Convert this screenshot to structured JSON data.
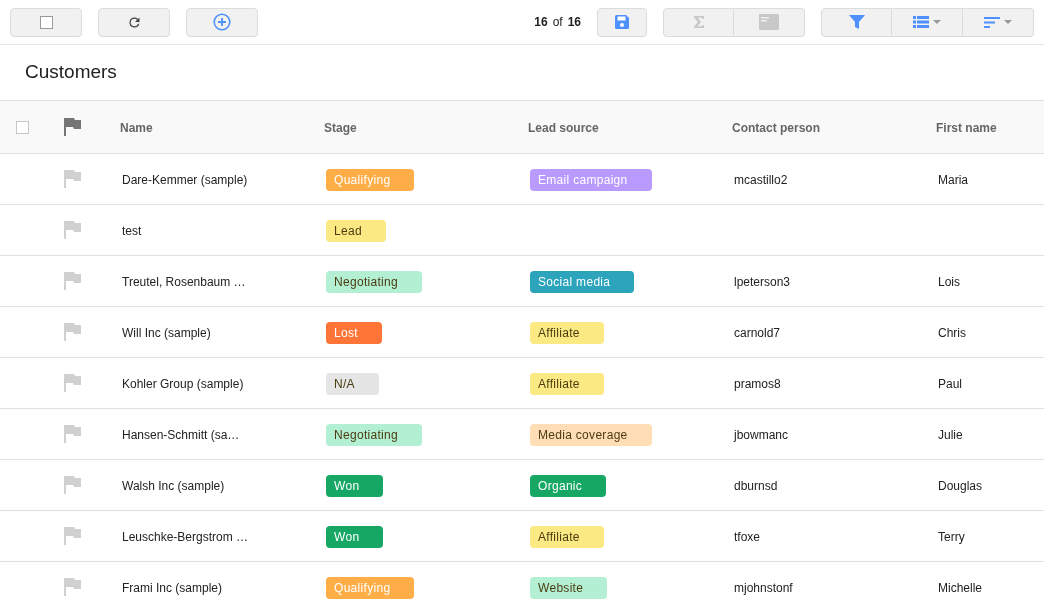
{
  "toolbar": {
    "count": "16",
    "of": "of",
    "total": "16"
  },
  "title": "Customers",
  "table": {
    "select_all": {
      "checked": false
    },
    "columns": [
      "Name",
      "Stage",
      "Lead source",
      "Contact person",
      "First name"
    ],
    "rows": [
      {
        "flagged": false,
        "name": "Dare-Kemmer (sample)",
        "stage": {
          "label": "Qualifying",
          "color": "#ffad47"
        },
        "lead_source": {
          "label": "Email campaign",
          "color": "#b99aff"
        },
        "contact": "mcastillo2",
        "first_name": "Maria"
      },
      {
        "flagged": false,
        "name": "test",
        "stage": {
          "label": "Lead",
          "color": "#fbe983"
        }
      },
      {
        "flagged": false,
        "name": "Treutel, Rosenbaum …",
        "stage": {
          "label": "Negotiating",
          "color": "#b3efd3"
        },
        "lead_source": {
          "label": "Social media",
          "color": "#2ca4bc"
        },
        "contact": "lpeterson3",
        "first_name": "Lois"
      },
      {
        "flagged": false,
        "name": "Will Inc (sample)",
        "stage": {
          "label": "Lost",
          "color": "#ff7537"
        },
        "lead_source": {
          "label": "Affiliate",
          "color": "#fbe983"
        },
        "contact": "carnold7",
        "first_name": "Chris"
      },
      {
        "flagged": false,
        "name": "Kohler Group (sample)",
        "stage": {
          "label": "N/A",
          "color": "#e5e5e5"
        },
        "lead_source": {
          "label": "Affiliate",
          "color": "#fbe983"
        },
        "contact": "pramos8",
        "first_name": "Paul"
      },
      {
        "flagged": false,
        "name": "Hansen-Schmitt (sa…",
        "stage": {
          "label": "Negotiating",
          "color": "#b3efd3"
        },
        "lead_source": {
          "label": "Media coverage",
          "color": "#ffdeb5"
        },
        "contact": "jbowmanc",
        "first_name": "Julie"
      },
      {
        "flagged": false,
        "name": "Walsh Inc (sample)",
        "stage": {
          "label": "Won",
          "color": "#16a765"
        },
        "lead_source": {
          "label": "Organic",
          "color": "#16a765"
        },
        "contact": "dburnsd",
        "first_name": "Douglas"
      },
      {
        "flagged": false,
        "name": "Leuschke-Bergstrom …",
        "stage": {
          "label": "Won",
          "color": "#16a765"
        },
        "lead_source": {
          "label": "Affiliate",
          "color": "#fbe983"
        },
        "contact": "tfoxe",
        "first_name": "Terry"
      },
      {
        "flagged": false,
        "name": "Frami Inc (sample)",
        "stage": {
          "label": "Qualifying",
          "color": "#ffad47"
        },
        "lead_source": {
          "label": "Website",
          "color": "#b3efd3"
        },
        "contact": "mjohnstonf",
        "first_name": "Michelle"
      }
    ]
  }
}
